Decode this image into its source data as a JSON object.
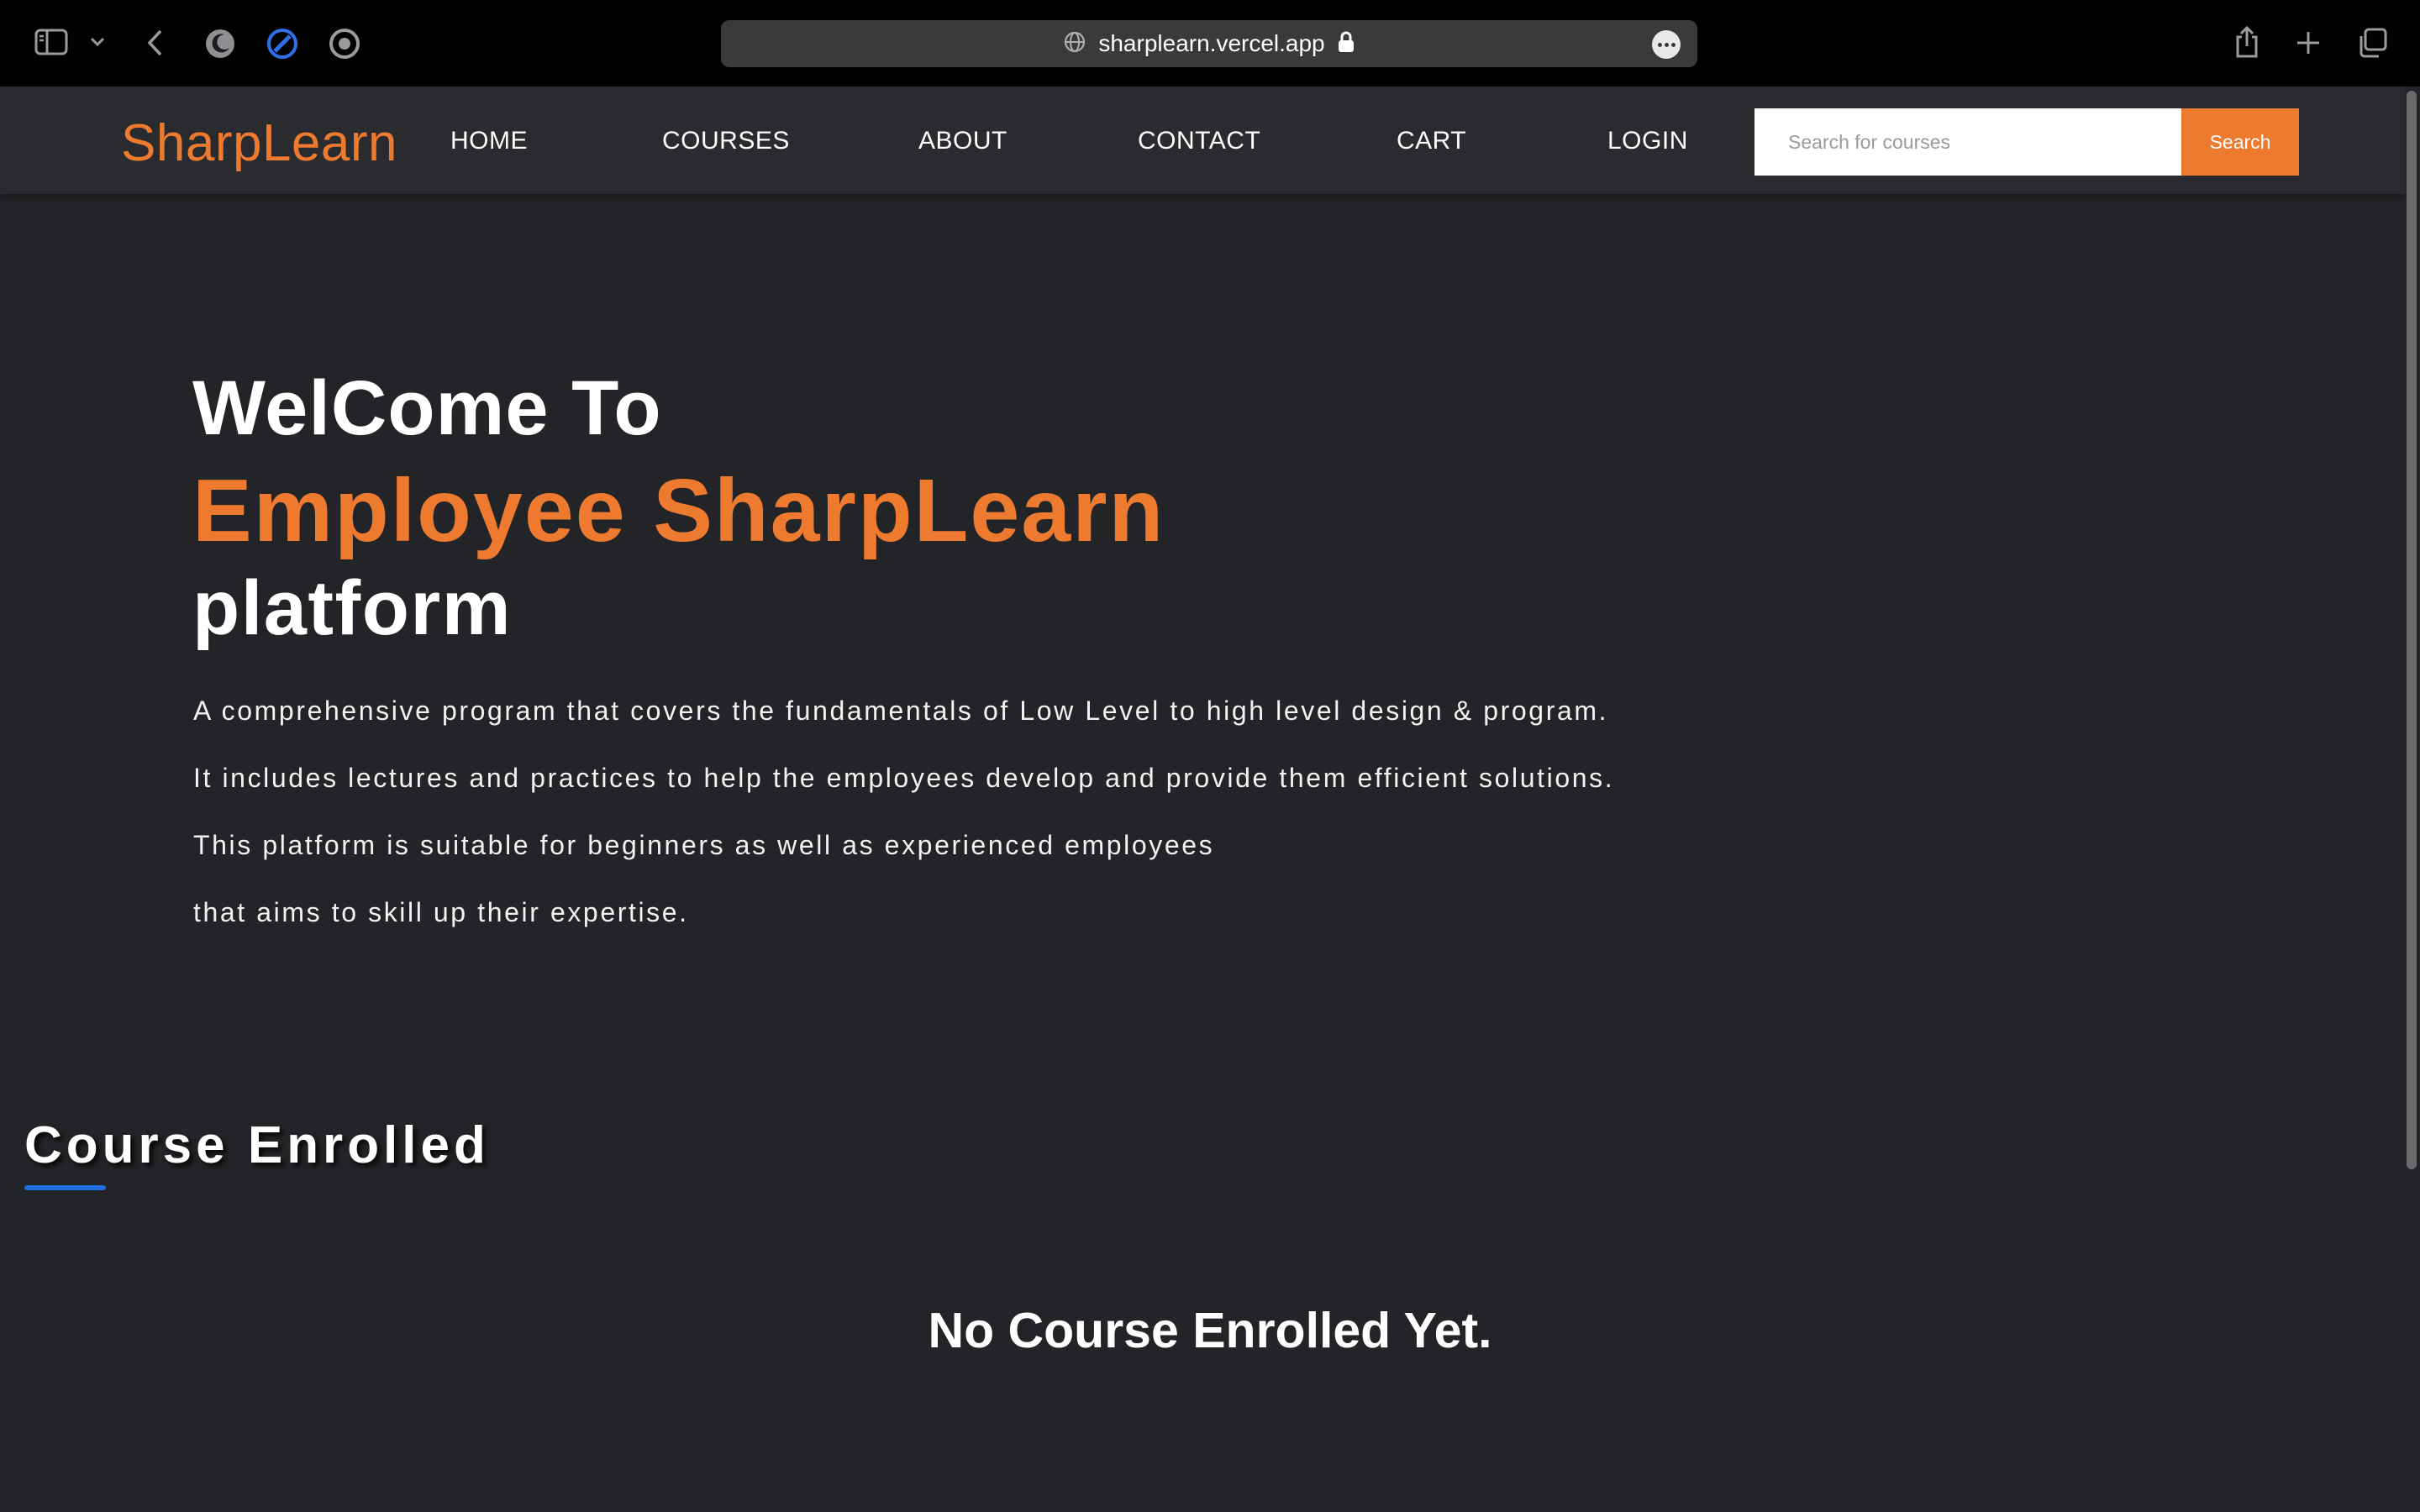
{
  "browser": {
    "url": "sharplearn.vercel.app",
    "icons": [
      "sidebar-icon",
      "chevron-down-icon",
      "back-icon",
      "moon-icon",
      "extension-icon",
      "record-icon",
      "globe-icon",
      "lock-icon",
      "more-icon",
      "share-icon",
      "plus-icon",
      "tabs-icon"
    ]
  },
  "navbar": {
    "brand": "SharpLearn",
    "links": [
      "HOME",
      "COURSES",
      "ABOUT",
      "CONTACT",
      "CART",
      "LOGIN"
    ],
    "search_placeholder": "Search for courses",
    "search_button": "Search"
  },
  "hero": {
    "line1": "WelCome To",
    "line2": "Employee SharpLearn",
    "line3": "platform",
    "paragraphs": [
      "A comprehensive program that covers the fundamentals of Low Level to high level design & program.",
      "It includes lectures and practices to help the employees develop and provide them efficient solutions.",
      "This platform is suitable for beginners as well as experienced employees",
      "that aims to skill up their expertise."
    ]
  },
  "enrolled": {
    "title": "Course Enrolled",
    "empty_message": "No Course Enrolled Yet."
  },
  "colors": {
    "accent": "#ee7a30",
    "background": "#232427",
    "navbar": "#2a2b2e",
    "underline": "#1d6fe0"
  }
}
